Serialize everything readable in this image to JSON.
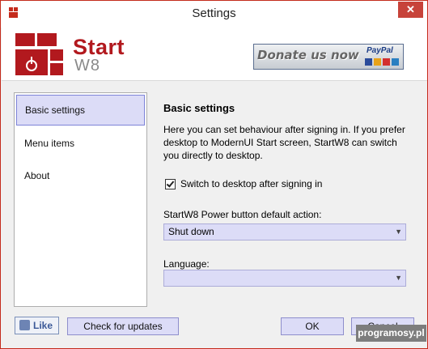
{
  "window": {
    "title": "Settings",
    "close_label": "✕"
  },
  "header": {
    "brand_start": "Start",
    "brand_w8": "W8",
    "donate_text": "Donate us now",
    "paypal_text": "PayPal"
  },
  "sidebar": {
    "items": [
      {
        "label": "Basic settings",
        "active": true
      },
      {
        "label": "Menu items",
        "active": false
      },
      {
        "label": "About",
        "active": false
      }
    ]
  },
  "content": {
    "title": "Basic settings",
    "description": "Here you can set behaviour after signing in. If you prefer desktop to ModernUI Start screen, StartW8 can switch you directly to desktop.",
    "checkbox_label": "Switch to desktop after signing in",
    "checkbox_checked": true,
    "power_label": "StartW8 Power button default action:",
    "power_value": "Shut down",
    "language_label": "Language:",
    "language_value": ""
  },
  "footer": {
    "like_label": "Like",
    "check_updates_label": "Check for updates",
    "ok_label": "OK",
    "cancel_label": "Cancel"
  },
  "watermark": "programosy.pl",
  "colors": {
    "accent": "#dcdcf7",
    "brand_red": "#b2191e",
    "close_red": "#c7433a"
  }
}
